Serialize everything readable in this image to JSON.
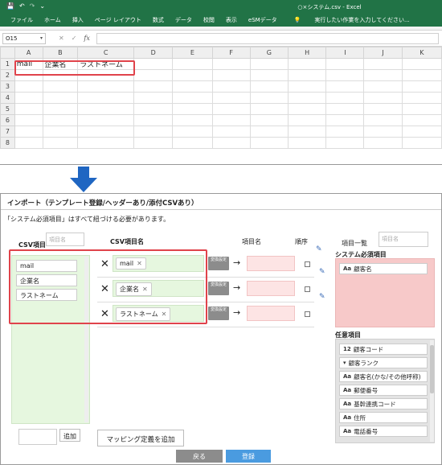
{
  "excel": {
    "window_title": "○×システム.csv - Excel",
    "ribbon_tabs": [
      "ファイル",
      "ホーム",
      "挿入",
      "ページ レイアウト",
      "数式",
      "データ",
      "校閲",
      "表示",
      "eSMデータ"
    ],
    "tell_me": "実行したい作業を入力してください...",
    "name_box": "O15",
    "fx_label": "fx",
    "columns": [
      "A",
      "B",
      "C",
      "D",
      "E",
      "F",
      "G",
      "H",
      "I",
      "J",
      "K"
    ],
    "rows": [
      "1",
      "2",
      "3",
      "4",
      "5",
      "6",
      "7",
      "8"
    ],
    "row1": [
      "mail",
      "企業名",
      "ラストネーム"
    ]
  },
  "dialog": {
    "title": "インポート（テンプレート登録/ヘッダーあり/添付CSVあり）",
    "note": "「システム必須項目」はすべて紐づける必要があります。",
    "csv_items_header": "CSV項目",
    "csv_items_placeholder": "項目名",
    "csv_items": [
      "mail",
      "企業名",
      "ラストネーム"
    ],
    "add_button": "追加",
    "mapping_header": "CSV項目名",
    "item_name_header": "項目名",
    "order_header": "順序",
    "mappings": [
      {
        "csv": "mail",
        "convert": "変換設定"
      },
      {
        "csv": "企業名",
        "convert": "変換設定"
      },
      {
        "csv": "ラストネーム",
        "convert": "変換設定"
      }
    ],
    "add_mapping_button": "マッピング定義を追加",
    "item_list_header": "項目一覧",
    "item_list_placeholder": "項目名",
    "system_required_header": "システム必須項目",
    "system_required": [
      {
        "icon": "Aa",
        "label": "顧客名"
      }
    ],
    "optional_header": "任意項目",
    "optional_items": [
      {
        "icon": "12",
        "label": "顧客コード"
      },
      {
        "icon": "▾",
        "label": "顧客ランク"
      },
      {
        "icon": "Aa",
        "label": "顧客名(かな/その他呼称)"
      },
      {
        "icon": "Aa",
        "label": "郵便番号"
      },
      {
        "icon": "Aa",
        "label": "基幹連携コード"
      },
      {
        "icon": "Aa",
        "label": "住所"
      },
      {
        "icon": "Aa",
        "label": "電話番号"
      }
    ],
    "back_button": "戻る",
    "register_button": "登録",
    "colors": {
      "excel_green": "#217346",
      "csv_green": "#e6f7df",
      "required_pink": "#f7c9c9",
      "register_blue": "#4a9be0",
      "highlight_red": "#e0434b"
    }
  }
}
